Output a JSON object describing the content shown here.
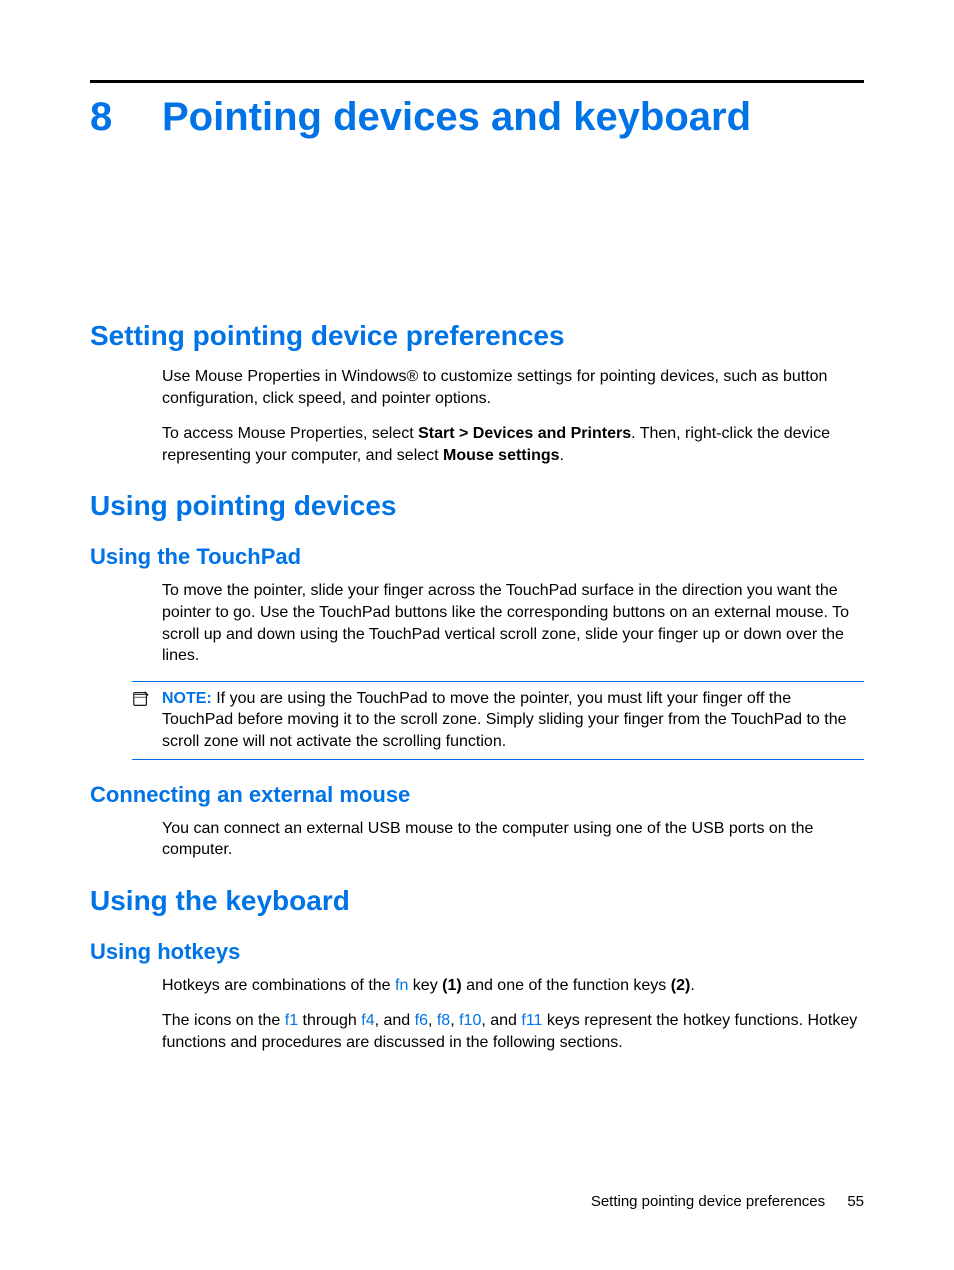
{
  "chapter": {
    "number": "8",
    "title": "Pointing devices and keyboard"
  },
  "h2_1": "Setting pointing device preferences",
  "p1": "Use Mouse Properties in Windows® to customize settings for pointing devices, such as button configuration, click speed, and pointer options.",
  "p2_a": "To access Mouse Properties, select ",
  "p2_b": "Start > Devices and Printers",
  "p2_c": ". Then, right-click the device representing your computer, and select ",
  "p2_d": "Mouse settings",
  "p2_e": ".",
  "h2_2": "Using pointing devices",
  "h3_1": "Using the TouchPad",
  "p3": "To move the pointer, slide your finger across the TouchPad surface in the direction you want the pointer to go. Use the TouchPad buttons like the corresponding buttons on an external mouse. To scroll up and down using the TouchPad vertical scroll zone, slide your finger up or down over the lines.",
  "note": {
    "label": "NOTE:",
    "text": "If you are using the TouchPad to move the pointer, you must lift your finger off the TouchPad before moving it to the scroll zone. Simply sliding your finger from the TouchPad to the scroll zone will not activate the scrolling function."
  },
  "h3_2": "Connecting an external mouse",
  "p4": "You can connect an external USB mouse to the computer using one of the USB ports on the computer.",
  "h2_3": "Using the keyboard",
  "h3_3": "Using hotkeys",
  "p5_a": "Hotkeys are combinations of the ",
  "p5_fn": "fn",
  "p5_b": " key ",
  "p5_b1": "(1)",
  "p5_c": " and one of the function keys ",
  "p5_c1": "(2)",
  "p5_d": ".",
  "p6_a": "The icons on the ",
  "p6_f1": "f1",
  "p6_b": " through ",
  "p6_f4": "f4",
  "p6_c": ", and ",
  "p6_f6": "f6",
  "p6_s1": ", ",
  "p6_f8": "f8",
  "p6_s2": ", ",
  "p6_f10": "f10",
  "p6_d": ", and ",
  "p6_f11": "f11",
  "p6_e": " keys represent the hotkey functions. Hotkey functions and procedures are discussed in the following sections.",
  "footer": {
    "section": "Setting pointing device preferences",
    "page": "55"
  }
}
